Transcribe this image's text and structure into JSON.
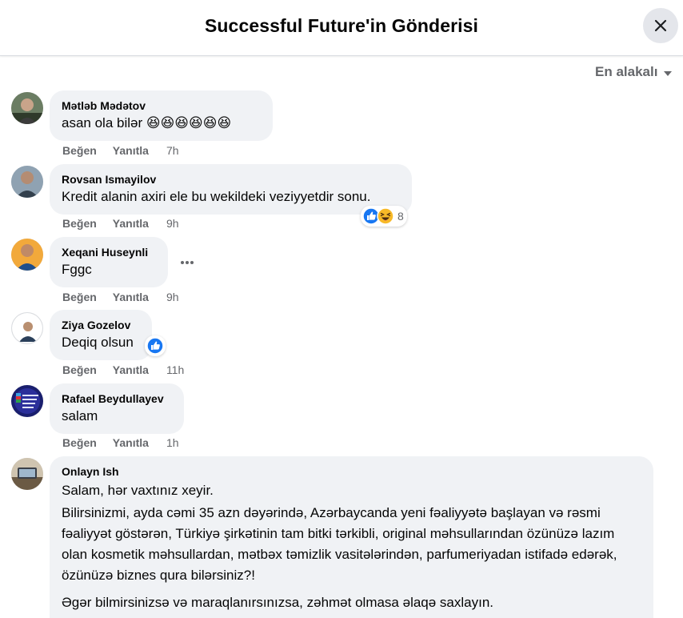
{
  "header": {
    "title": "Successful Future'in Gönderisi"
  },
  "sort": {
    "label": "En alakalı"
  },
  "actions": {
    "like": "Beğen",
    "reply": "Yanıtla"
  },
  "colors": {
    "bubble": "#f0f2f5",
    "secondary_text": "#65676b",
    "like_blue": "#1877f2",
    "haha_yellow": "#f7b928"
  },
  "comments": [
    {
      "author": "Mətləb Mədətov",
      "text": "asan ola bilər 😆😆😆😆😆😆",
      "time": "7h"
    },
    {
      "author": "Rovsan Ismayilov",
      "text": "Kredit alanin axiri ele bu wekildeki veziyyetdir sonu.",
      "time": "9h",
      "reactions": {
        "types": [
          "like",
          "haha"
        ],
        "count": "8"
      }
    },
    {
      "author": "Xeqani Huseynli",
      "text": "Fggc",
      "time": "9h"
    },
    {
      "author": "Ziya Gozelov",
      "text": "Deqiq olsun",
      "time": "11h",
      "reactions": {
        "types": [
          "like"
        ],
        "count": ""
      }
    },
    {
      "author": "Rafael Beydullayev",
      "text": "salam",
      "time": "1h"
    },
    {
      "author": "Onlayn Ish",
      "paragraphs": [
        "Salam, hər vaxtınız xeyir.",
        "Bilirsinizmi, ayda cəmi 35 azn dəyərində, Azərbaycanda yeni fəaliyyətə başlayan və rəsmi fəaliyyət göstərən, Türkiyə şirkətinin tam bitki tərkibli, original məhsullarından özünüzə lazım olan kosmetik məhsullardan, mətbəx təmizlik vasitələrindən, parfumeriyadan istifadə edərək, özünüzə biznes qura bilərsiniz?!",
        "Əgər bilmirsinizsə və maraqlanırsınızsa, zəhmət olmasa əlaqə saxlayın."
      ]
    }
  ]
}
